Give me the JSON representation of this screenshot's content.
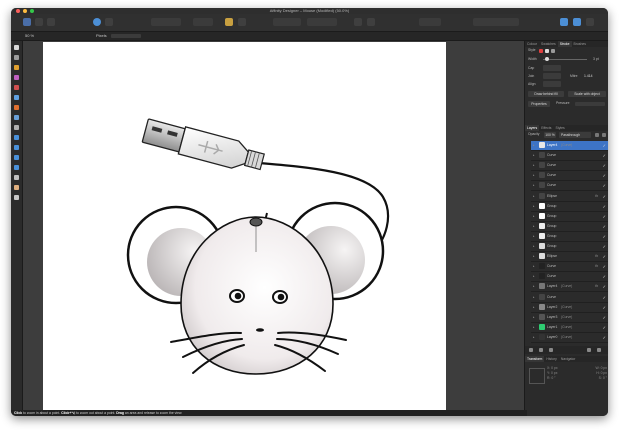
{
  "app": {
    "title": "Affinity Designer – Mouse (Modified) (50.0%)",
    "zoom": "50 %",
    "context_label": "Pixels"
  },
  "right_panel": {
    "top_tabs": [
      "Colour",
      "Swatches",
      "Stroke",
      "Brushes"
    ],
    "active_top_tab": "Stroke",
    "style_label": "Style",
    "width_label": "Width",
    "width_value": "3 pt",
    "cap_label": "Cap",
    "join_label": "Join",
    "mitre_label": "Mitre",
    "mitre_value": "1.414",
    "align_label": "Align",
    "draw_behind_label": "Draw behind fill",
    "scale_with_object_label": "Scale with object",
    "properties_label": "Properties",
    "pressure_label": "Pressure",
    "layer_tabs": [
      "Layers",
      "Effects",
      "Styles"
    ],
    "active_layer_tab": "Layers",
    "opacity_label": "Opacity",
    "opacity_value": "100 %",
    "blend_label": "Passthrough",
    "transform_tabs": [
      "Transform",
      "History",
      "Navigator"
    ],
    "active_transform_tab": "Transform",
    "transform_fields": [
      "X:",
      "Y:",
      "W:",
      "H:",
      "R:",
      "S:"
    ],
    "transform_values": [
      "0 px",
      "0 px",
      "0 px",
      "0 px",
      "0 °",
      "0 °"
    ]
  },
  "layers": [
    {
      "name": "Layer4",
      "sub": "(Curve)",
      "selected": true,
      "thumb": "#e8e8e8",
      "fx": false
    },
    {
      "name": "Curve",
      "sub": "",
      "selected": false,
      "thumb": "#444444",
      "fx": false
    },
    {
      "name": "Curve",
      "sub": "",
      "selected": false,
      "thumb": "#444444",
      "fx": false
    },
    {
      "name": "Curve",
      "sub": "",
      "selected": false,
      "thumb": "#444444",
      "fx": false
    },
    {
      "name": "Curve",
      "sub": "",
      "selected": false,
      "thumb": "#444444",
      "fx": false
    },
    {
      "name": "Ellipse",
      "sub": "",
      "selected": false,
      "thumb": "#444444",
      "fx": true
    },
    {
      "name": "Group",
      "sub": "",
      "selected": false,
      "thumb": "#ffffff",
      "fx": false
    },
    {
      "name": "Group",
      "sub": "",
      "selected": false,
      "thumb": "#ffffff",
      "fx": false
    },
    {
      "name": "Group",
      "sub": "",
      "selected": false,
      "thumb": "#eeeeee",
      "fx": false
    },
    {
      "name": "Group",
      "sub": "",
      "selected": false,
      "thumb": "#eeeeee",
      "fx": false
    },
    {
      "name": "Group",
      "sub": "",
      "selected": false,
      "thumb": "#dddddd",
      "fx": false
    },
    {
      "name": "Ellipse",
      "sub": "",
      "selected": false,
      "thumb": "#dddddd",
      "fx": true
    },
    {
      "name": "Curve",
      "sub": "",
      "selected": false,
      "thumb": "#222222",
      "fx": true
    },
    {
      "name": "Curve",
      "sub": "",
      "selected": false,
      "thumb": "#222222",
      "fx": false
    },
    {
      "name": "Layer4",
      "sub": "(Curve)",
      "selected": false,
      "thumb": "#777777",
      "fx": true
    },
    {
      "name": "Curve",
      "sub": "",
      "selected": false,
      "thumb": "#444444",
      "fx": false
    },
    {
      "name": "Layer2",
      "sub": "(Curve)",
      "selected": false,
      "thumb": "#888888",
      "fx": false
    },
    {
      "name": "Layer3",
      "sub": "(Curve)",
      "selected": false,
      "thumb": "#555555",
      "fx": false
    },
    {
      "name": "Layer1",
      "sub": "(Curve)",
      "selected": false,
      "thumb": "#2ecc71",
      "fx": false
    },
    {
      "name": "Layer0",
      "sub": "(Curve)",
      "selected": false,
      "thumb": "#333333",
      "fx": false
    }
  ],
  "status_bar": {
    "click_word": "Click",
    "text1": " to zoom in about a point. ",
    "click2": "Click+⌥",
    "text2": " to zoom out about a point. ",
    "drag_word": "Drag",
    "text3": " an area and release to zoom the view."
  },
  "colors": {
    "window_bg": "#2a2a2a",
    "panel_bg": "#2b2b2b",
    "selection": "#3d74c6",
    "mouse_body": "#efeaeb"
  }
}
